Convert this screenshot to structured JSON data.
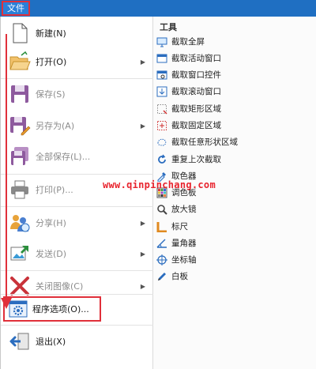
{
  "menubar": {
    "file_tab": "文件"
  },
  "menu": {
    "new": "新建(N)",
    "open": "打开(O)",
    "save": "保存(S)",
    "save_as": "另存为(A)",
    "save_all": "全部保存(L)...",
    "print": "打印(P)...",
    "share": "分享(H)",
    "send": "发送(D)",
    "close_image": "关闭图像(C)",
    "options": "程序选项(O)...",
    "exit": "退出(X)"
  },
  "tools": {
    "header": "工具",
    "items": [
      "截取全屏",
      "截取活动窗口",
      "截取窗口控件",
      "截取滚动窗口",
      "截取矩形区域",
      "截取固定区域",
      "截取任意形状区域",
      "重复上次截取",
      "取色器",
      "调色板",
      "放大镜",
      "标尺",
      "量角器",
      "坐标轴",
      "白板"
    ]
  },
  "watermark": "www.qinpinchang.com",
  "colors": {
    "accent": "#1f6fc2",
    "highlight": "#e0303a",
    "watermark": "#e8242e"
  }
}
